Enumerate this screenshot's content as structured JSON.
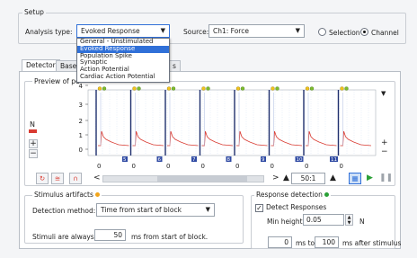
{
  "setup": {
    "group_label": "Setup",
    "analysis_type_label": "Analysis type:",
    "analysis_type_value": "Evoked Response",
    "analysis_type_options": [
      "General - Unstimulated",
      "Evoked Response",
      "Population Spike",
      "Synaptic",
      "Action Potential",
      "Cardiac Action Potential"
    ],
    "source_label": "Source:",
    "source_value": "Ch1: Force",
    "mode_options": [
      "Selection",
      "Channel"
    ],
    "mode_selected": "Channel"
  },
  "tabs": [
    "Detector",
    "Basel",
    "s"
  ],
  "preview": {
    "label": "Preview of pe",
    "y_ticks": [
      "4",
      "3",
      "2",
      "1",
      "0"
    ],
    "channel_label": "N",
    "block_numbers": [
      "5",
      "6",
      "7",
      "8",
      "9",
      "10",
      "11"
    ],
    "block_zeros": [
      "0",
      "0",
      "0",
      "0",
      "0",
      "0",
      "0",
      "0"
    ],
    "zoom": "50:1",
    "marker_colors": {
      "green": "#7dbb2e",
      "yellow": "#f2c21b",
      "red_trace": "#d93b32",
      "block_line": "#1f2f6d",
      "block_tag": "#2f4aa3"
    }
  },
  "stimulus": {
    "group_label": "Stimulus artifacts",
    "method_label": "Detection method:",
    "method_value": "Time from start of block",
    "always_prefix": "Stimuli are always",
    "always_value": "50",
    "always_suffix": "ms from start of block."
  },
  "response": {
    "group_label": "Response detection",
    "detect_label": "Detect Responses",
    "min_height_label": "Min height:",
    "min_height_value": "0.05",
    "min_height_unit": "N",
    "from_value": "0",
    "ms_to": "ms to",
    "to_value": "100",
    "after_label": "ms after stimulus"
  }
}
